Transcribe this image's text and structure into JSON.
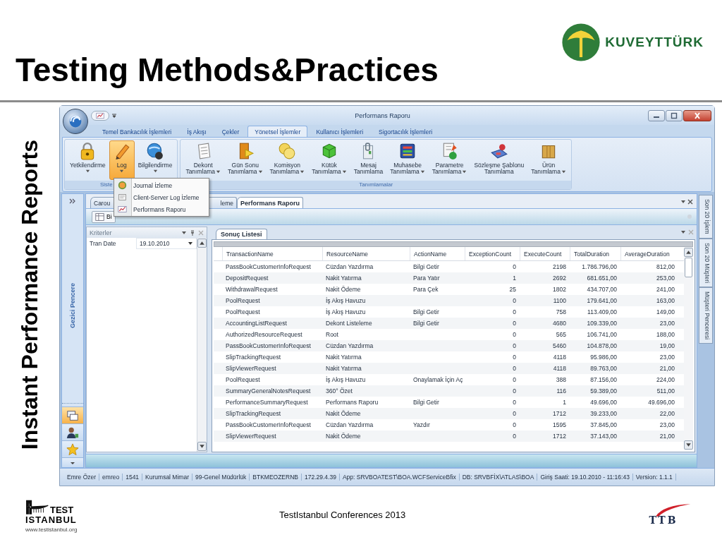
{
  "slide": {
    "title": "Testing Methods&Practices",
    "side_title": "Instant Performance Reports",
    "footer_text": "TestIstanbul Conferences 2013"
  },
  "logos": {
    "sponsor": "KUVEYTTÜRK",
    "conference": [
      "TEST",
      "ISTANBUL"
    ],
    "conference_url": "www.testistanbul.org",
    "partner": "TTB"
  },
  "window": {
    "title": "Performans Raporu"
  },
  "ribbon_tabs": [
    {
      "label": "Temel Bankacılık İşlemleri",
      "selected": false
    },
    {
      "label": "İş Akışı",
      "selected": false
    },
    {
      "label": "Çekler",
      "selected": false
    },
    {
      "label": "Yönetsel İşlemler",
      "selected": true
    },
    {
      "label": "Kullanıcı İşlemleri",
      "selected": false
    },
    {
      "label": "Sigortacılık İşlemleri",
      "selected": false
    }
  ],
  "ribbon_groups": [
    {
      "label": "Siste",
      "buttons": [
        {
          "lines": [
            "Yetkilendirme"
          ],
          "dropdown": true,
          "selected": false
        },
        {
          "lines": [
            "Log"
          ],
          "dropdown": true,
          "selected": true
        },
        {
          "lines": [
            "Bilgilendirme"
          ],
          "dropdown": true,
          "selected": false
        }
      ]
    },
    {
      "label": "Tanımlamalar",
      "buttons": [
        {
          "lines": [
            "Dekont",
            "Tanımlama"
          ],
          "dropdown": true,
          "selected": false
        },
        {
          "lines": [
            "Gün Sonu",
            "Tanımlama"
          ],
          "dropdown": true,
          "selected": false
        },
        {
          "lines": [
            "Komisyon",
            "Tanımlama"
          ],
          "dropdown": true,
          "selected": false
        },
        {
          "lines": [
            "Kütük",
            "Tanımlama"
          ],
          "dropdown": true,
          "selected": false
        },
        {
          "lines": [
            "Mesaj",
            "Tanımlama"
          ],
          "dropdown": false,
          "selected": false
        },
        {
          "lines": [
            "Muhasebe",
            "Tanımlama"
          ],
          "dropdown": true,
          "selected": false
        },
        {
          "lines": [
            "Parametre",
            "Tanımlama"
          ],
          "dropdown": true,
          "selected": false
        },
        {
          "lines": [
            "Sözleşme Şablonu",
            "Tanımlama"
          ],
          "dropdown": false,
          "selected": false
        },
        {
          "lines": [
            "Ürün",
            "Tanımlama"
          ],
          "dropdown": true,
          "selected": false
        }
      ]
    }
  ],
  "log_menu": [
    "Journal İzleme",
    "Client-Server Log İzleme",
    "Performans Raporu"
  ],
  "document_tabs": [
    {
      "label": "Carou",
      "selected": false
    },
    {
      "label": "leme",
      "selected": false
    },
    {
      "label": "Performans Raporu",
      "selected": true
    }
  ],
  "toolbar": {
    "button": "Bi"
  },
  "navigator": {
    "label": "Gezici Pencere"
  },
  "criteria": {
    "title": "Kriterler",
    "fields": [
      {
        "label": "Tran Date",
        "value": "19.10.2010"
      }
    ]
  },
  "results": {
    "title": "Sonuç Listesi",
    "columns": [
      {
        "label": "TransactionName",
        "kind": "text"
      },
      {
        "label": "ResourceName",
        "kind": "text"
      },
      {
        "label": "ActionName",
        "kind": "text"
      },
      {
        "label": "ExceptionCount",
        "kind": "number"
      },
      {
        "label": "ExecuteCount",
        "kind": "number"
      },
      {
        "label": "TotalDuration",
        "kind": "number"
      },
      {
        "label": "AverageDuration",
        "kind": "number"
      }
    ],
    "rows": [
      [
        "PassBookCustomerInfoRequest",
        "Cüzdan Yazdırma",
        "Bilgi Getir",
        "0",
        "2198",
        "1.786.796,00",
        "812,00"
      ],
      [
        "DepositRequest",
        "Nakit Yatırma",
        "Para Yatır",
        "1",
        "2692",
        "681.651,00",
        "253,00"
      ],
      [
        "WithdrawalRequest",
        "Nakit Ödeme",
        "Para Çek",
        "25",
        "1802",
        "434.707,00",
        "241,00"
      ],
      [
        "PoolRequest",
        "İş Akış Havuzu",
        null,
        "0",
        "1100",
        "179.641,00",
        "163,00"
      ],
      [
        "PoolRequest",
        "İş Akış Havuzu",
        "Bilgi Getir",
        "0",
        "758",
        "113.409,00",
        "149,00"
      ],
      [
        "AccountingListRequest",
        "Dekont Listeleme",
        "Bilgi Getir",
        "0",
        "4680",
        "109.339,00",
        "23,00"
      ],
      [
        "AuthorizedResourceRequest",
        "Root",
        null,
        "0",
        "565",
        "106.741,00",
        "188,00"
      ],
      [
        "PassBookCustomerInfoRequest",
        "Cüzdan Yazdırma",
        null,
        "0",
        "5460",
        "104.878,00",
        "19,00"
      ],
      [
        "SlipTrackingRequest",
        "Nakit Yatırma",
        null,
        "0",
        "4118",
        "95.986,00",
        "23,00"
      ],
      [
        "SlipViewerRequest",
        "Nakit Yatırma",
        null,
        "0",
        "4118",
        "89.763,00",
        "21,00"
      ],
      [
        "PoolRequest",
        "İş Akış Havuzu",
        "Onaylamak İçin Aç",
        "0",
        "388",
        "87.156,00",
        "224,00"
      ],
      [
        "SummaryGeneralNotesRequest",
        "360° Özet",
        null,
        "0",
        "116",
        "59.389,00",
        "511,00"
      ],
      [
        "PerformanceSummaryRequest",
        "Performans Raporu",
        "Bilgi Getir",
        "0",
        "1",
        "49.696,00",
        "49.696,00"
      ],
      [
        "SlipTrackingRequest",
        "Nakit Ödeme",
        null,
        "0",
        "1712",
        "39.233,00",
        "22,00"
      ],
      [
        "PassBookCustomerInfoRequest",
        "Cüzdan Yazdırma",
        "Yazdır",
        "0",
        "1595",
        "37.845,00",
        "23,00"
      ],
      [
        "SlipViewerRequest",
        "Nakit Ödeme",
        null,
        "0",
        "1712",
        "37.143,00",
        "21,00"
      ]
    ]
  },
  "side_tabs": [
    "Son 20 İşlem",
    "Son 20 Müşteri",
    "Müşteri Penceresi"
  ],
  "status_bar": [
    "Emre Özer",
    "emreo",
    "1541",
    "Kurumsal Mimar",
    "99-Genel Müdürlük",
    "BTKMEOZERNB",
    "172.29.4.39",
    "App: SRVBOATEST\\BOA.WCFServiceBfix",
    "DB: SRVBFİX\\ATLAS\\BOA",
    "Giriş Saati: 19.10.2010 - 11:16:43",
    "Version: 1.1.1"
  ]
}
